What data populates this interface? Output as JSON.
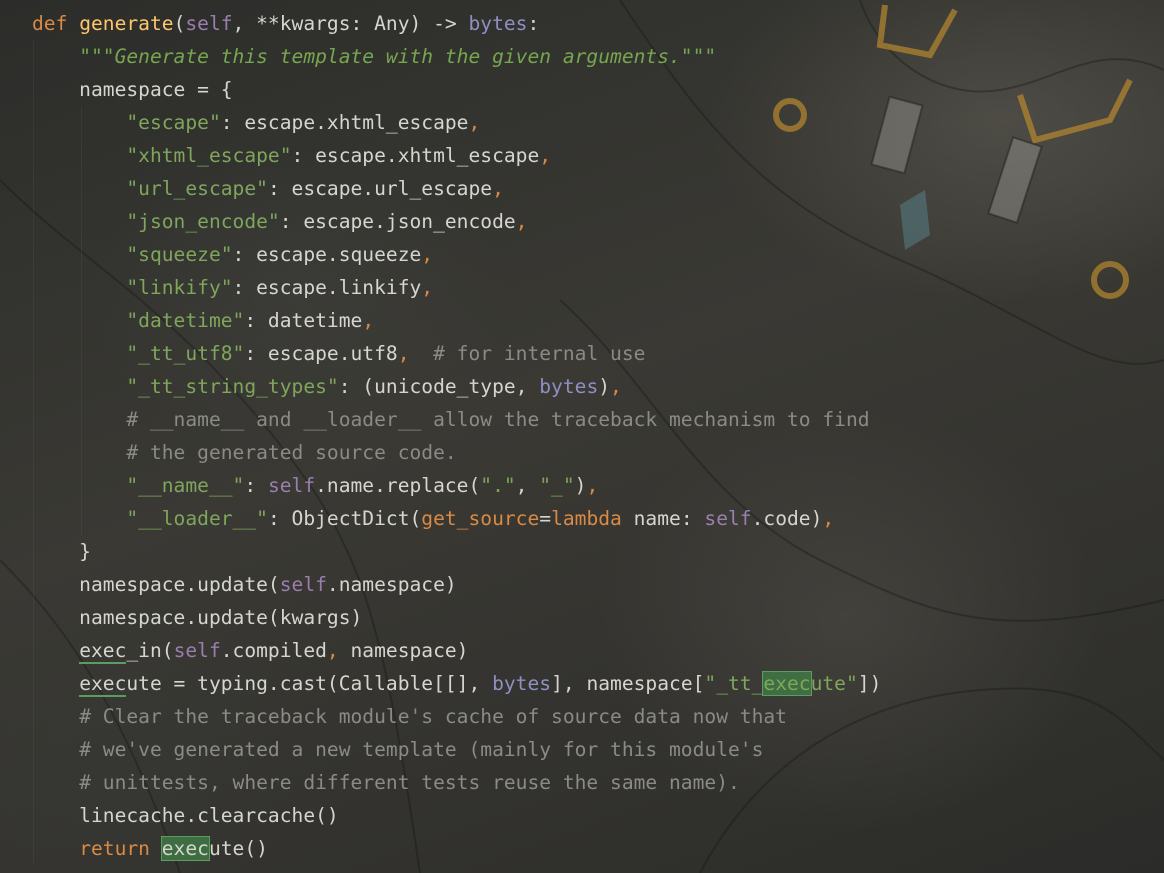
{
  "editor": {
    "lines": [
      {
        "segs": [
          [
            "def",
            "kw"
          ],
          [
            " ",
            ""
          ],
          [
            "generate",
            "fn"
          ],
          [
            "(",
            ""
          ],
          [
            "self",
            "self"
          ],
          [
            ", **kwargs: Any) -> ",
            ""
          ],
          [
            "bytes",
            "builtin"
          ],
          [
            ":",
            ""
          ]
        ]
      },
      {
        "segs": [
          [
            "    ",
            ""
          ],
          [
            "\"\"\"Generate this template with the given arguments.\"\"\"",
            "doc"
          ]
        ]
      },
      {
        "segs": [
          [
            "    namespace = {",
            ""
          ]
        ]
      },
      {
        "segs": [
          [
            "        ",
            ""
          ],
          [
            "\"escape\"",
            "str"
          ],
          [
            ": escape.xhtml_escape",
            ""
          ],
          [
            ",",
            "comma"
          ]
        ]
      },
      {
        "segs": [
          [
            "        ",
            ""
          ],
          [
            "\"xhtml_escape\"",
            "str"
          ],
          [
            ": escape.xhtml_escape",
            ""
          ],
          [
            ",",
            "comma"
          ]
        ]
      },
      {
        "segs": [
          [
            "        ",
            ""
          ],
          [
            "\"url_escape\"",
            "str"
          ],
          [
            ": escape.url_escape",
            ""
          ],
          [
            ",",
            "comma"
          ]
        ]
      },
      {
        "segs": [
          [
            "        ",
            ""
          ],
          [
            "\"json_encode\"",
            "str"
          ],
          [
            ": escape.json_encode",
            ""
          ],
          [
            ",",
            "comma"
          ]
        ]
      },
      {
        "segs": [
          [
            "        ",
            ""
          ],
          [
            "\"squeeze\"",
            "str"
          ],
          [
            ": escape.squeeze",
            ""
          ],
          [
            ",",
            "comma"
          ]
        ]
      },
      {
        "segs": [
          [
            "        ",
            ""
          ],
          [
            "\"linkify\"",
            "str"
          ],
          [
            ": escape.linkify",
            ""
          ],
          [
            ",",
            "comma"
          ]
        ]
      },
      {
        "segs": [
          [
            "        ",
            ""
          ],
          [
            "\"datetime\"",
            "str"
          ],
          [
            ": datetime",
            ""
          ],
          [
            ",",
            "comma"
          ]
        ]
      },
      {
        "segs": [
          [
            "        ",
            ""
          ],
          [
            "\"_tt_utf8\"",
            "str"
          ],
          [
            ": escape.utf8",
            ""
          ],
          [
            ",",
            "comma"
          ],
          [
            "  # for internal use",
            "com"
          ]
        ]
      },
      {
        "segs": [
          [
            "        ",
            ""
          ],
          [
            "\"_tt_string_types\"",
            "str"
          ],
          [
            ": (unicode_type, ",
            ""
          ],
          [
            "bytes",
            "builtin"
          ],
          [
            ")",
            ""
          ],
          [
            ",",
            "comma"
          ]
        ]
      },
      {
        "segs": [
          [
            "        ",
            ""
          ],
          [
            "# __name__ and __loader__ allow the traceback mechanism to find",
            "com"
          ]
        ]
      },
      {
        "segs": [
          [
            "        ",
            ""
          ],
          [
            "# the generated source code.",
            "com"
          ]
        ]
      },
      {
        "segs": [
          [
            "        ",
            ""
          ],
          [
            "\"__name__\"",
            "str"
          ],
          [
            ": ",
            ""
          ],
          [
            "self",
            "self"
          ],
          [
            ".name.replace(",
            ""
          ],
          [
            "\".\"",
            "str"
          ],
          [
            ", ",
            ""
          ],
          [
            "\"_\"",
            "str"
          ],
          [
            ")",
            ""
          ],
          [
            ",",
            "comma"
          ]
        ]
      },
      {
        "segs": [
          [
            "        ",
            ""
          ],
          [
            "\"__loader__\"",
            "str"
          ],
          [
            ": ObjectDict(",
            ""
          ],
          [
            "get_source",
            "param"
          ],
          [
            "=",
            ""
          ],
          [
            "lambda",
            "kw"
          ],
          [
            " name: ",
            ""
          ],
          [
            "self",
            "self"
          ],
          [
            ".code)",
            ""
          ],
          [
            ",",
            "comma"
          ]
        ]
      },
      {
        "segs": [
          [
            "    }",
            ""
          ]
        ]
      },
      {
        "segs": [
          [
            "    namespace.update(",
            ""
          ],
          [
            "self",
            "self"
          ],
          [
            ".namespace)",
            ""
          ]
        ]
      },
      {
        "segs": [
          [
            "    namespace.update(kwargs)",
            ""
          ]
        ]
      },
      {
        "segs": [
          [
            "    ",
            ""
          ],
          [
            "exec",
            "hl-soft"
          ],
          [
            "_in(",
            ""
          ],
          [
            "self",
            "self"
          ],
          [
            ".compiled",
            ""
          ],
          [
            ",",
            "comma"
          ],
          [
            " namespace)",
            ""
          ]
        ]
      },
      {
        "segs": [
          [
            "    ",
            ""
          ],
          [
            "exec",
            "hl-soft"
          ],
          [
            "ute = typing.cast(Callable[[], ",
            ""
          ],
          [
            "bytes",
            "builtin"
          ],
          [
            "], namespace[",
            ""
          ],
          [
            "\"_tt_",
            "str"
          ],
          [
            "exec",
            "str hl"
          ],
          [
            "ute\"",
            "str"
          ],
          [
            "])",
            ""
          ]
        ]
      },
      {
        "segs": [
          [
            "    ",
            ""
          ],
          [
            "# Clear the traceback module's cache of source data now that",
            "com"
          ]
        ]
      },
      {
        "segs": [
          [
            "    ",
            ""
          ],
          [
            "# we've generated a new template (mainly for this module's",
            "com"
          ]
        ]
      },
      {
        "segs": [
          [
            "    ",
            ""
          ],
          [
            "# unittests, where different tests reuse the same name).",
            "com"
          ]
        ]
      },
      {
        "segs": [
          [
            "    linecache.clearcache()",
            ""
          ]
        ]
      },
      {
        "segs": [
          [
            "    ",
            ""
          ],
          [
            "return",
            "kw"
          ],
          [
            " ",
            ""
          ],
          [
            "exec",
            "hl"
          ],
          [
            "ute()",
            ""
          ]
        ]
      }
    ]
  }
}
